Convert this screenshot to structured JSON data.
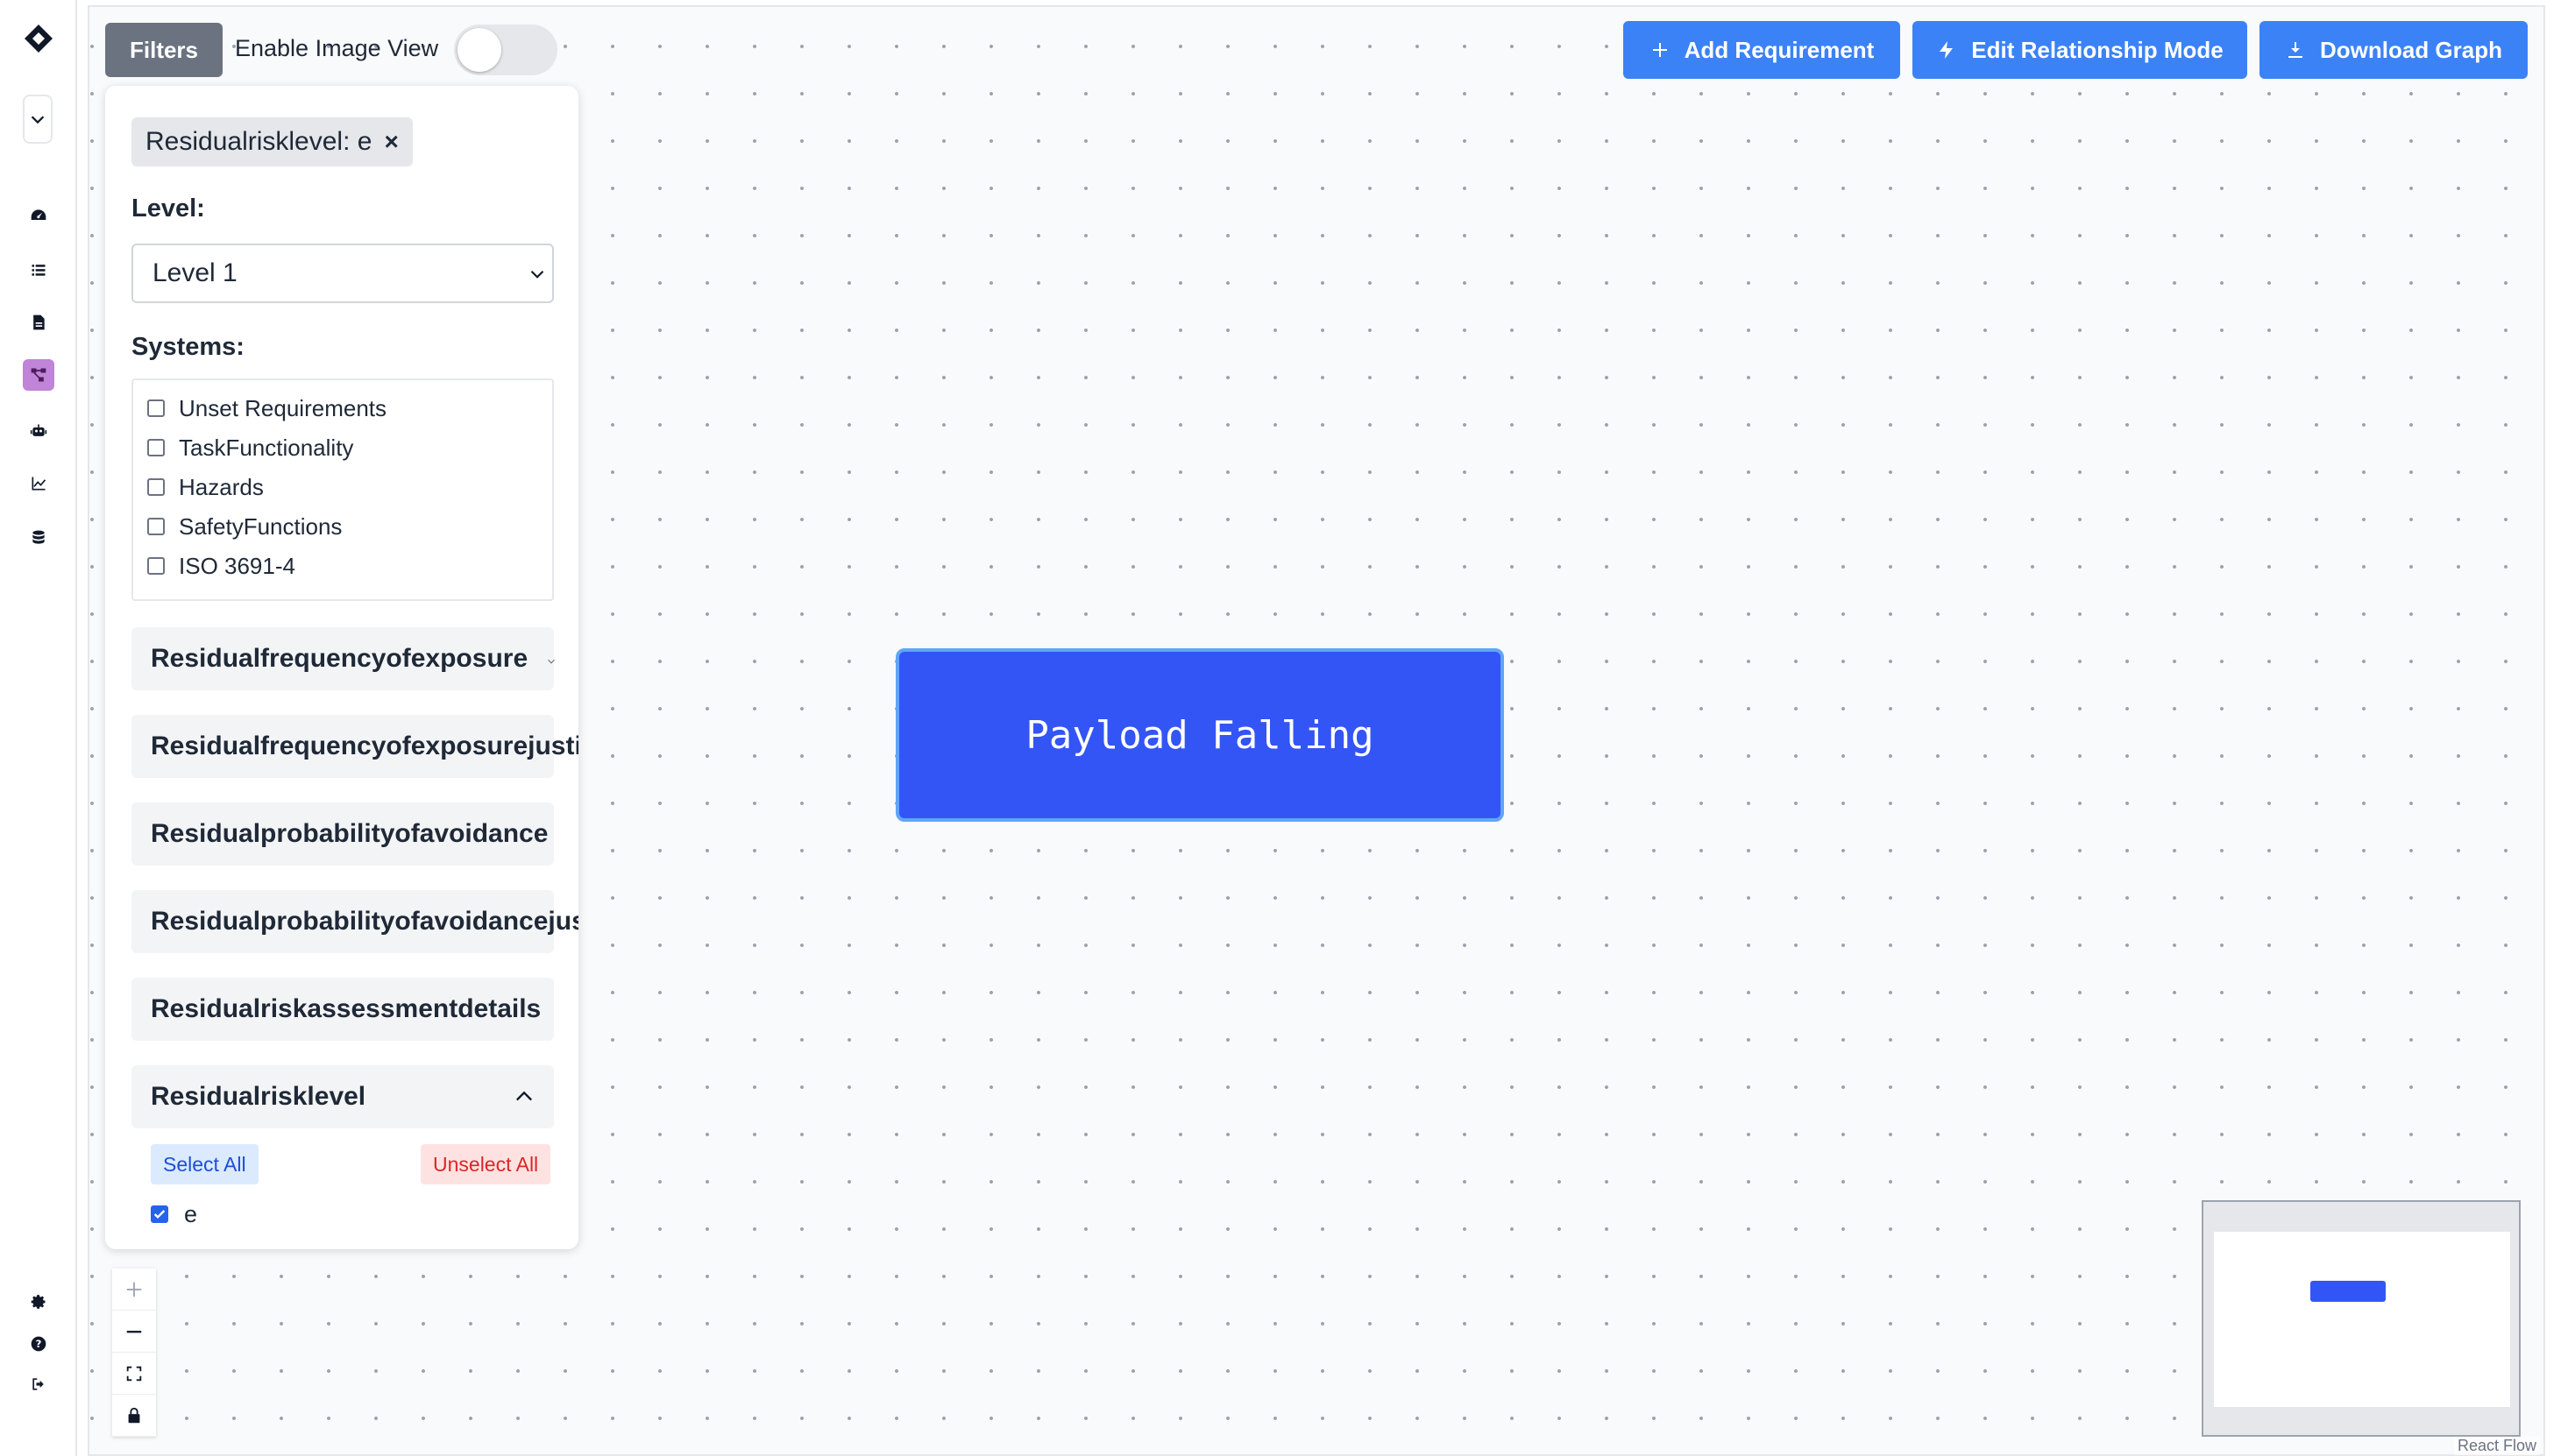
{
  "toolbar": {
    "filters_label": "Filters",
    "image_view_label": "Enable Image View",
    "image_view_enabled": false,
    "add_requirement_label": "Add Requirement",
    "edit_relationship_label": "Edit Relationship Mode",
    "download_graph_label": "Download Graph",
    "accent_color": "#3b82f6"
  },
  "sidebar": {
    "icons": [
      "logo-icon",
      "chevron-down-icon",
      "dashboard-icon",
      "list-icon",
      "document-icon",
      "graph-icon",
      "robot-icon",
      "chart-icon",
      "database-icon",
      "gear-icon",
      "help-icon",
      "logout-icon"
    ],
    "active": "graph-icon",
    "active_color": "#c084d8"
  },
  "filter_panel": {
    "active_chip": "Residualrisklevel: e",
    "chip_remove": "×",
    "level_label": "Level:",
    "level_value": "Level 1",
    "systems_label": "Systems:",
    "systems": [
      {
        "label": "Unset Requirements",
        "checked": false
      },
      {
        "label": "TaskFunctionality",
        "checked": false
      },
      {
        "label": "Hazards",
        "checked": false
      },
      {
        "label": "SafetyFunctions",
        "checked": false
      },
      {
        "label": "ISO 3691-4",
        "checked": false
      }
    ],
    "accordions": [
      {
        "label": "Residualfrequencyofexposure"
      },
      {
        "label": "Residualfrequencyofexposurejustification"
      },
      {
        "label": "Residualprobabilityofavoidance"
      },
      {
        "label": "Residualprobabilityofavoidancejustification"
      },
      {
        "label": "Residualriskassessmentdetails"
      },
      {
        "label": "Residualrisklevel",
        "expanded": true
      }
    ],
    "select_all_label": "Select All",
    "unselect_all_label": "Unselect All",
    "risk_level_options": [
      {
        "label": "e",
        "checked": true
      }
    ]
  },
  "graph": {
    "node_label": "Payload Falling",
    "node_color": "#3355f5"
  },
  "attribution": "React Flow"
}
